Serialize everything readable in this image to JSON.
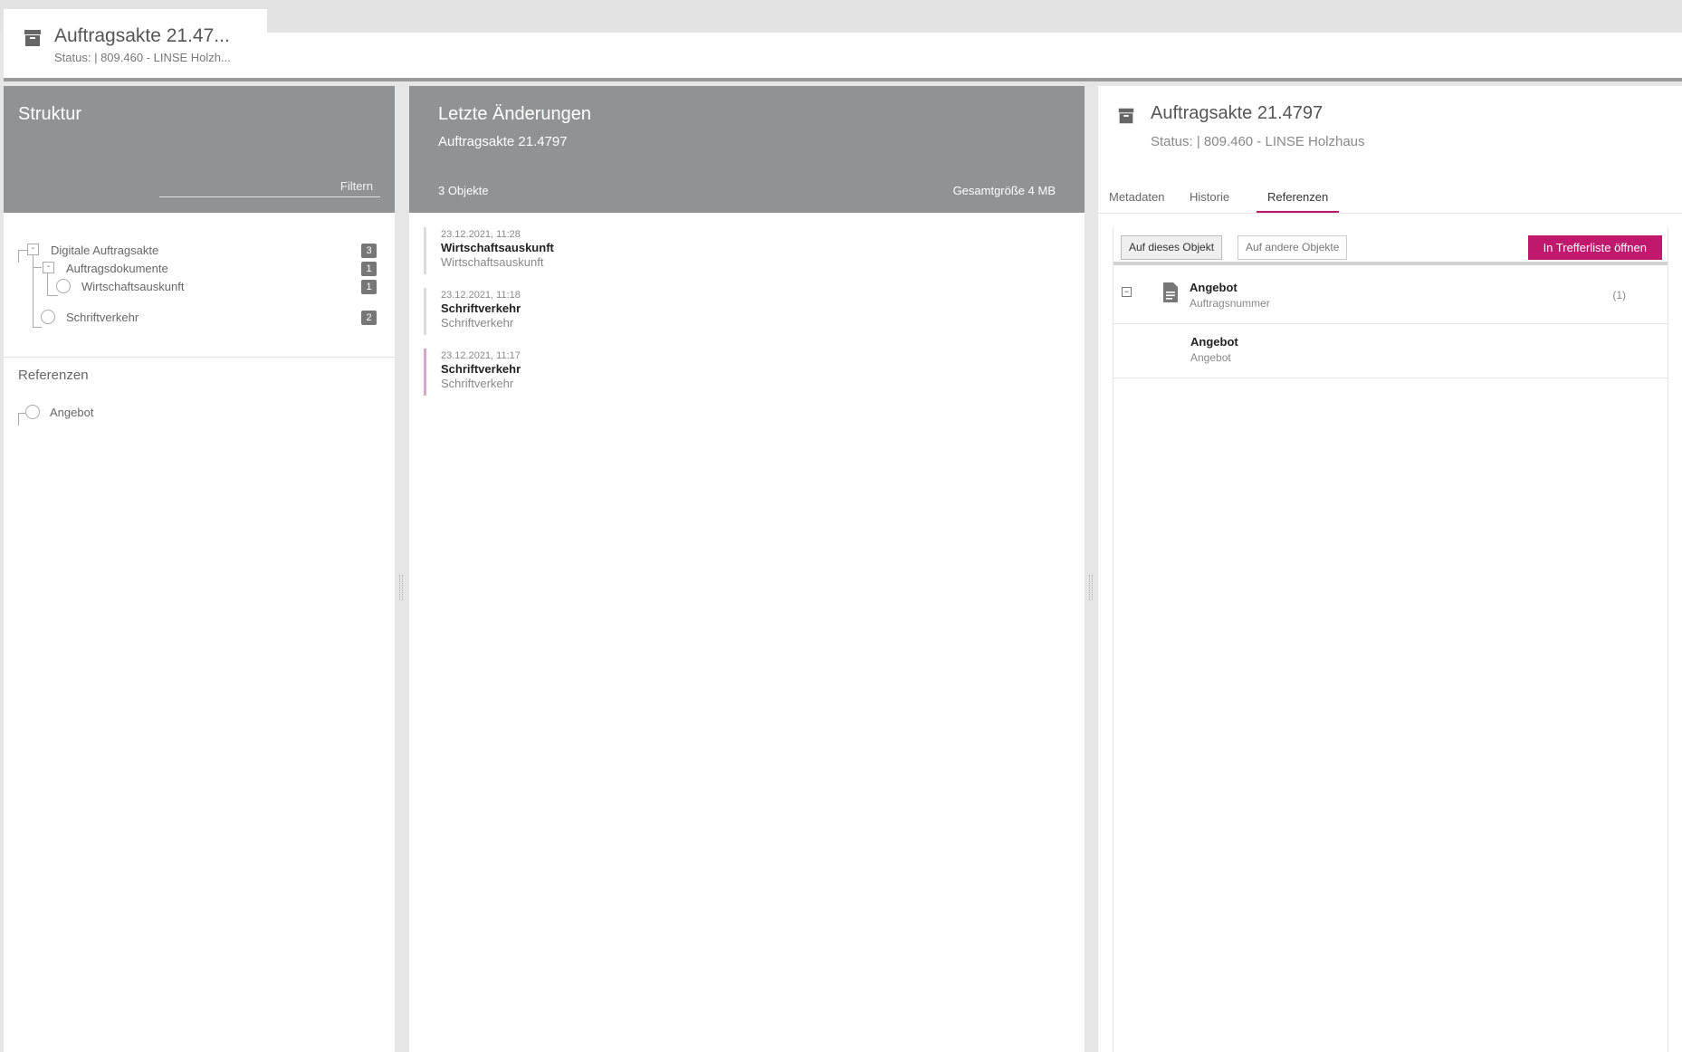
{
  "top_tab": {
    "icon": "archive-box-icon",
    "title": "Auftragsakte 21.47...",
    "subtitle": "Status: | 809.460 - LINSE Holzh..."
  },
  "structure": {
    "title": "Struktur",
    "filter_placeholder": "Filtern",
    "tree": [
      {
        "label": "Digitale Auftragsakte",
        "count": "3"
      },
      {
        "label": "Auftragsdokumente",
        "count": "1"
      },
      {
        "label": "Wirtschaftsauskunft",
        "count": "1"
      },
      {
        "label": "Schriftverkehr",
        "count": "2"
      }
    ],
    "references_title": "Referenzen",
    "references": [
      {
        "label": "Angebot"
      }
    ]
  },
  "changes": {
    "title": "Letzte Änderungen",
    "subtitle": "Auftragsakte 21.4797",
    "count": "3 Objekte",
    "size": "Gesamtgröße 4 MB",
    "items": [
      {
        "date": "23.12.2021, 11:28",
        "title": "Wirtschaftsauskunft",
        "sub": "Wirtschaftsauskunft"
      },
      {
        "date": "23.12.2021, 11:18",
        "title": "Schriftverkehr",
        "sub": "Schriftverkehr"
      },
      {
        "date": "23.12.2021, 11:17",
        "title": "Schriftverkehr",
        "sub": "Schriftverkehr"
      }
    ]
  },
  "detail": {
    "icon": "archive-box-icon",
    "title": "Auftragsakte 21.4797",
    "subtitle": "Status: | 809.460 - LINSE Holzhaus",
    "tabs": [
      "Metadaten",
      "Historie",
      "Referenzen"
    ],
    "active_tab": "Referenzen",
    "buttons": {
      "this_object": "Auf dieses Objekt",
      "other_objects": "Auf andere Objekte",
      "open_hitlist": "In Trefferliste öffnen"
    },
    "references": [
      {
        "title": "Angebot",
        "sub": "Auftragsnummer",
        "count": "(1)",
        "icon": "document-icon",
        "collapse": "−"
      },
      {
        "title": "Angebot",
        "sub": "Angebot"
      }
    ]
  },
  "colors": {
    "accent": "#c0186d",
    "header_gray": "#909393"
  }
}
